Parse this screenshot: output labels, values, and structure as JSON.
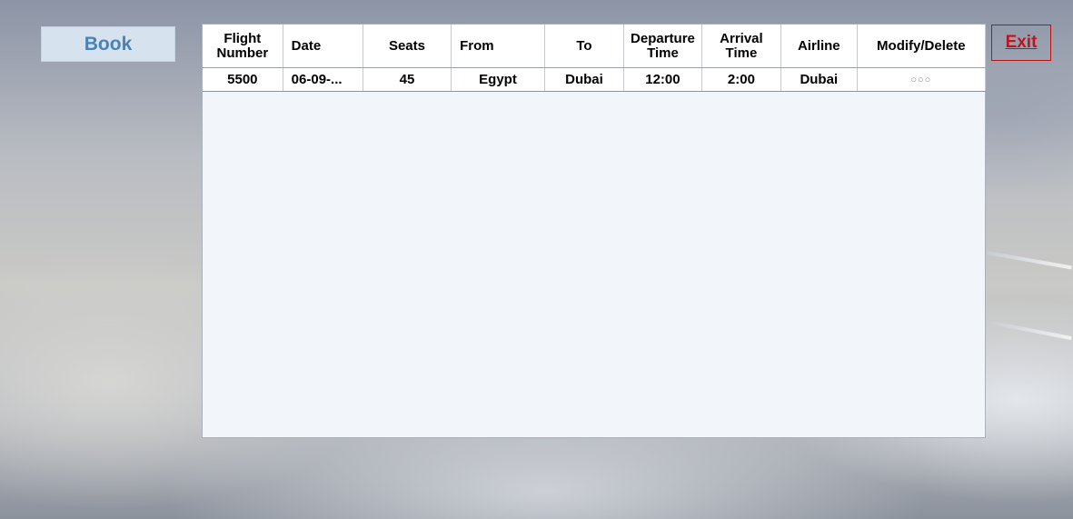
{
  "actions": {
    "book_label": "Book",
    "exit_label": "Exit"
  },
  "flights_table": {
    "columns": [
      "Flight Number",
      "Date",
      "Seats",
      "From",
      "To",
      "Departure Time",
      "Arrival Time",
      "Airline",
      "Modify/Delete"
    ],
    "rows": [
      [
        "5500",
        "06-09-...",
        "45",
        "Egypt",
        "Dubai",
        "12:00",
        "2:00",
        "Dubai",
        "○○○"
      ]
    ]
  }
}
